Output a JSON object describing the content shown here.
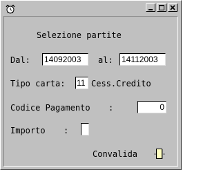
{
  "heading": "Selezione partite",
  "dal": {
    "label": "Dal:",
    "value": "14092003"
  },
  "al": {
    "label": "al:",
    "value": "14112003"
  },
  "tipo_carta": {
    "label": "Tipo carta:",
    "value": "11",
    "description": "Cess.Credito"
  },
  "codice_pagamento": {
    "label": "Codice Pagamento",
    "colon": ":",
    "value": "0"
  },
  "importo": {
    "label": "Importo",
    "colon": ":",
    "value": ""
  },
  "convalida": {
    "label": "Convalida"
  },
  "colors": {
    "face": "#c0c0c0",
    "field": "#ffffff",
    "toggle": "#ffffc0"
  },
  "icons": [
    "alarm-clock-icon",
    "minimize-icon",
    "maximize-icon",
    "close-icon"
  ]
}
